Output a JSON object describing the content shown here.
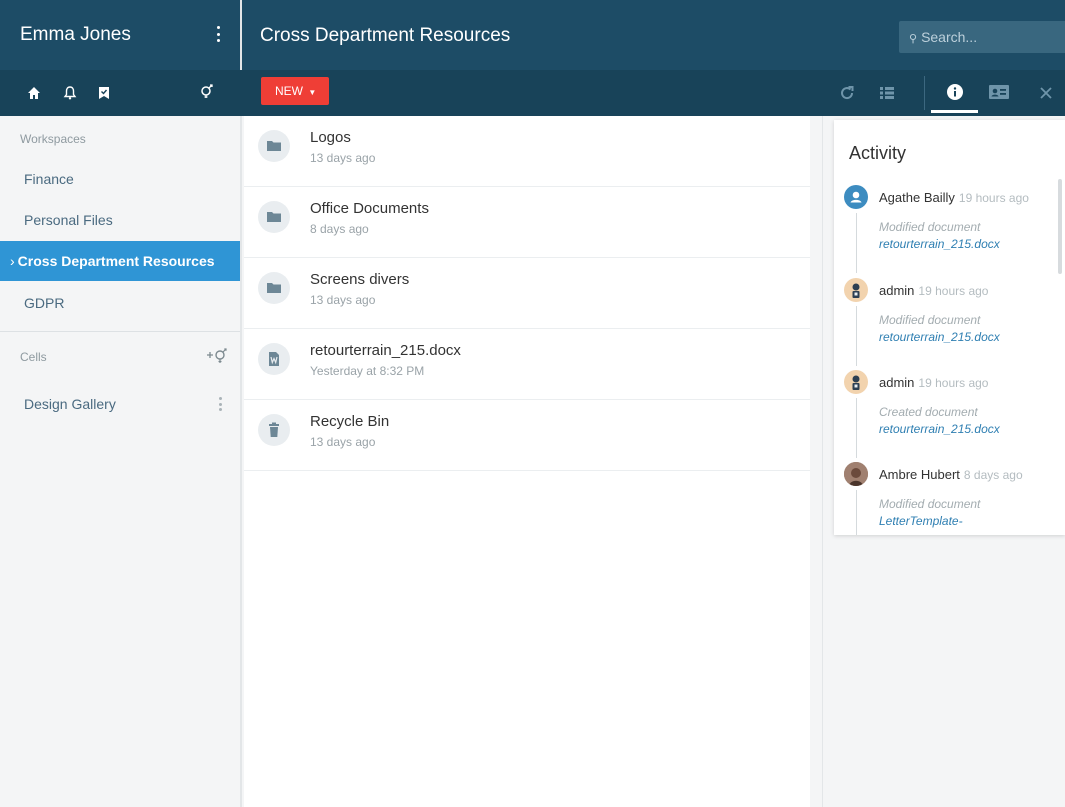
{
  "sidebar": {
    "user_name": "Emma Jones",
    "workspaces_label": "Workspaces",
    "workspaces": [
      {
        "label": "Finance"
      },
      {
        "label": "Personal Files"
      },
      {
        "label": "Cross Department Resources",
        "active": true
      },
      {
        "label": "GDPR"
      }
    ],
    "cells_label": "Cells",
    "cells": [
      {
        "label": "Design Gallery"
      }
    ]
  },
  "header": {
    "title": "Cross Department Resources",
    "search_placeholder": "Search..."
  },
  "toolbar": {
    "new_label": "NEW"
  },
  "files": [
    {
      "name": "Logos",
      "date": "13 days ago",
      "icon": "folder-icon"
    },
    {
      "name": "Office Documents",
      "date": "8 days ago",
      "icon": "folder-icon"
    },
    {
      "name": "Screens divers",
      "date": "13 days ago",
      "icon": "folder-icon"
    },
    {
      "name": "retourterrain_215.docx",
      "date": "Yesterday at 8:32 PM",
      "icon": "word-document-icon"
    },
    {
      "name": "Recycle Bin",
      "date": "13 days ago",
      "icon": "trash-icon"
    }
  ],
  "activity": {
    "title": "Activity",
    "entries": [
      {
        "user": "Agathe Bailly",
        "time": "19 hours ago",
        "action": "Modified document",
        "doc": "retourterrain_215.docx",
        "avatar": "default-user-avatar"
      },
      {
        "user": "admin",
        "time": "19 hours ago",
        "action": "Modified document",
        "doc": "retourterrain_215.docx",
        "avatar": "admin-avatar"
      },
      {
        "user": "admin",
        "time": "19 hours ago",
        "action": "Created document",
        "doc": "retourterrain_215.docx",
        "avatar": "admin-avatar"
      },
      {
        "user": "Ambre Hubert",
        "time": "8 days ago",
        "action": "Modified document",
        "doc": "LetterTemplate-",
        "avatar": "photo-avatar"
      }
    ]
  },
  "colors": {
    "header_bg": "#1d4c66",
    "toolbar_bg": "#184359",
    "active_item": "#2f95d5",
    "new_button": "#ef3e36",
    "link": "#2f7fb2"
  }
}
